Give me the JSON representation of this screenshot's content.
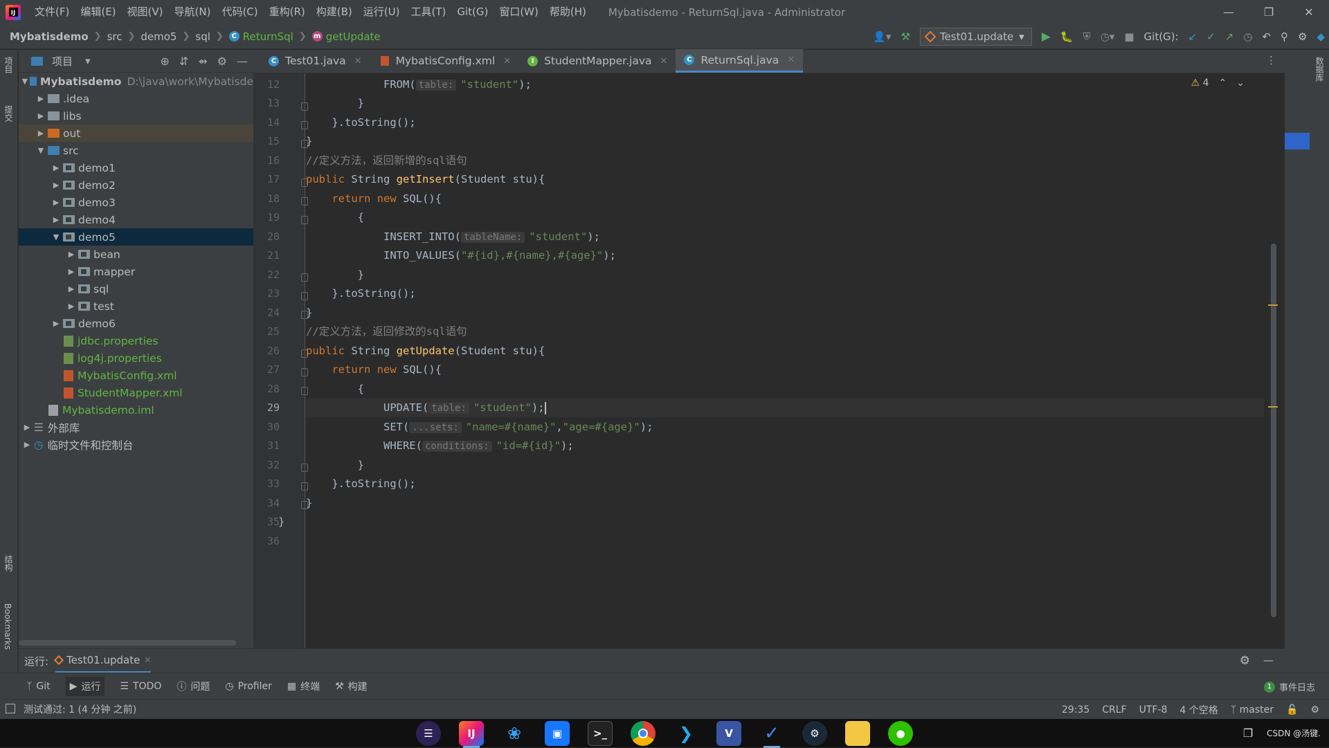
{
  "menu": [
    "文件(F)",
    "编辑(E)",
    "视图(V)",
    "导航(N)",
    "代码(C)",
    "重构(R)",
    "构建(B)",
    "运行(U)",
    "工具(T)",
    "Git(G)",
    "窗口(W)",
    "帮助(H)"
  ],
  "window_title": "Mybatisdemo - ReturnSql.java - Administrator",
  "breadcrumb": {
    "project": "Mybatisdemo",
    "p1": "src",
    "p2": "demo5",
    "p3": "sql",
    "cls": "ReturnSql",
    "method": "getUpdate"
  },
  "toolbar": {
    "run_config": "Test01.update",
    "git_label": "Git(G):"
  },
  "project_panel": {
    "title": "项目"
  },
  "tree": [
    {
      "label": "Mybatisdemo",
      "path": "D:\\java\\work\\Mybatisde"
    },
    {
      "label": ".idea"
    },
    {
      "label": "libs"
    },
    {
      "label": "out"
    },
    {
      "label": "src"
    },
    {
      "label": "demo1"
    },
    {
      "label": "demo2"
    },
    {
      "label": "demo3"
    },
    {
      "label": "demo4"
    },
    {
      "label": "demo5"
    },
    {
      "label": "bean"
    },
    {
      "label": "mapper"
    },
    {
      "label": "sql"
    },
    {
      "label": "test"
    },
    {
      "label": "demo6"
    },
    {
      "label": "jdbc.properties"
    },
    {
      "label": "log4j.properties"
    },
    {
      "label": "MybatisConfig.xml"
    },
    {
      "label": "StudentMapper.xml"
    },
    {
      "label": "Mybatisdemo.iml"
    },
    {
      "label": "外部库"
    },
    {
      "label": "临时文件和控制台"
    }
  ],
  "tabs": [
    "Test01.java",
    "MybatisConfig.xml",
    "StudentMapper.java",
    "ReturnSql.java"
  ],
  "line_numbers": [
    "12",
    "13",
    "14",
    "15",
    "16",
    "17",
    "18",
    "19",
    "20",
    "21",
    "22",
    "23",
    "24",
    "25",
    "26",
    "27",
    "28",
    "29",
    "30",
    "31",
    "32",
    "33",
    "34",
    "35",
    "36"
  ],
  "code": {
    "l12_a": "FROM(",
    "l12_hint": "table:",
    "l12_str": "\"student\"",
    "l12_b": ");",
    "l13": "}",
    "l14": "}.toString();",
    "l15": "}",
    "l16": "//定义方法，返回新增的sql语句",
    "l17_kw": "public",
    "l17_t": " String ",
    "l17_fn": "getInsert",
    "l17_p": "(Student ",
    "l17_v": "stu",
    "l17_e": "){",
    "l18_kw": "return new",
    "l18_e": " SQL(){",
    "l19": "{",
    "l20_a": "INSERT_INTO(",
    "l20_hint": "tableName:",
    "l20_str": "\"student\"",
    "l20_b": ");",
    "l21_a": "INTO_VALUES(",
    "l21_str": "\"#{id},#{name},#{age}\"",
    "l21_b": ");",
    "l22": "}",
    "l23": "}.toString();",
    "l24": "}",
    "l25": "//定义方法，返回修改的sql语句",
    "l26_kw": "public",
    "l26_t": " String ",
    "l26_fn": "getUpdate",
    "l26_p": "(Student ",
    "l26_v": "stu",
    "l26_e": "){",
    "l27_kw": "return new",
    "l27_e": " SQL(){",
    "l28": "{",
    "l29_a": "UPDATE(",
    "l29_hint": "table:",
    "l29_str": "\"student\"",
    "l29_b": ");",
    "l30_a": "SET(",
    "l30_hint": "...sets:",
    "l30_s1": "\"name=#{name}\"",
    "l30_c": ",",
    "l30_s2": "\"age=#{age}\"",
    "l30_b": ");",
    "l31_a": "WHERE(",
    "l31_hint": "conditions:",
    "l31_str": "\"id=#{id}\"",
    "l31_b": ");",
    "l32": "}",
    "l33": "}.toString();",
    "l34": "}",
    "l35": "}"
  },
  "warnings": "4",
  "run_panel": {
    "label": "运行:",
    "config": "Test01.update"
  },
  "tool_windows": [
    "Git",
    "运行",
    "TODO",
    "问题",
    "Profiler",
    "终端",
    "构建"
  ],
  "event_log": {
    "count": "1",
    "label": "事件日志"
  },
  "status": {
    "message": "测试通过: 1 (4 分钟 之前)",
    "position": "29:35",
    "line_sep": "CRLF",
    "encoding": "UTF-8",
    "indent": "4 个空格",
    "branch": "master"
  },
  "side_labels": {
    "project": "项目",
    "commit": "提交",
    "structure": "结构",
    "bookmarks": "Bookmarks",
    "database": "数据库"
  },
  "taskbar": {
    "right_text": "CSDN @汤键."
  }
}
